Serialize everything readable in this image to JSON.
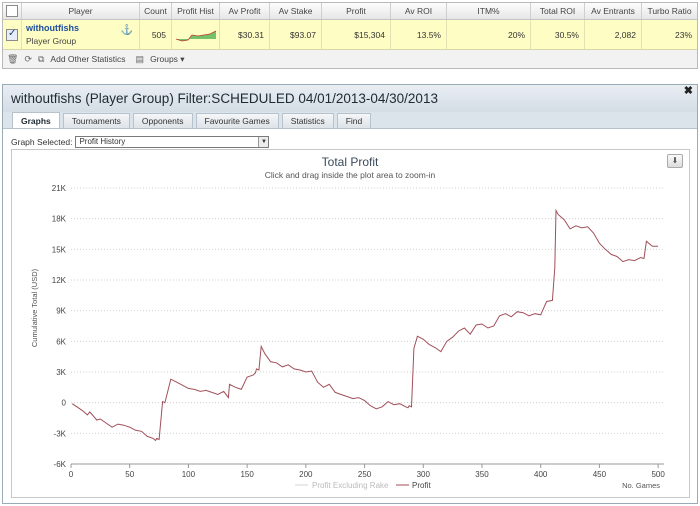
{
  "stats_table": {
    "headers": [
      "Player",
      "Count",
      "Profit Hist",
      "Av Profit",
      "Av Stake",
      "Profit",
      "Av ROI",
      "ITM%",
      "Total ROI",
      "Av Entrants",
      "Turbo Ratio"
    ],
    "row": {
      "player_name": "withoutfishs",
      "player_group": "Player Group",
      "count": "505",
      "av_profit": "$30.31",
      "av_stake": "$93.07",
      "profit": "$15,304",
      "av_roi": "13.5%",
      "itm": "20%",
      "total_roi": "30.5%",
      "av_entrants": "2,082",
      "turbo_ratio": "23%"
    },
    "toolbar": {
      "add_stats_label": "Add Other Statistics",
      "groups_label": "Groups"
    }
  },
  "panel": {
    "title": "withoutfishs (Player Group) Filter:SCHEDULED 04/01/2013-04/30/2013",
    "tabs": [
      "Graphs",
      "Tournaments",
      "Opponents",
      "Favourite Games",
      "Statistics",
      "Find"
    ],
    "active_tab": "Graphs",
    "graph_selected_label": "Graph Selected:",
    "graph_selected_value": "Profit History"
  },
  "colors": {
    "accent_blue": "#1f4fa0",
    "row_highlight": "#fdfdc4",
    "profit_line": "#a0505a",
    "excl_rake_line": "#d6d6d6"
  },
  "chart_data": {
    "type": "line",
    "title": "Total Profit",
    "subtitle": "Click and drag inside the plot area to zoom-in",
    "xlabel": "No. Games",
    "ylabel": "Cumulative Total (USD)",
    "xlim": [
      0,
      505
    ],
    "ylim": [
      -6000,
      21000
    ],
    "xticks": [
      0,
      50,
      100,
      150,
      200,
      250,
      300,
      350,
      400,
      450,
      500
    ],
    "yticks": [
      -6000,
      -3000,
      0,
      3000,
      6000,
      9000,
      12000,
      15000,
      18000,
      21000
    ],
    "ytick_labels": [
      "-6K",
      "-3K",
      "0",
      "3K",
      "6K",
      "9K",
      "12K",
      "15K",
      "18K",
      "21K"
    ],
    "grid": "horizontal-dotted",
    "legend_position": "bottom-center",
    "series": [
      {
        "name": "Profit Excluding Rake",
        "color": "#d6d6d6",
        "visible": false,
        "x": [],
        "y": []
      },
      {
        "name": "Profit",
        "color": "#a0505a",
        "x": [
          1,
          5,
          10,
          14,
          16,
          22,
          25,
          30,
          35,
          40,
          45,
          50,
          55,
          60,
          65,
          70,
          72,
          73,
          75,
          78,
          80,
          85,
          90,
          95,
          100,
          105,
          110,
          115,
          120,
          125,
          130,
          134,
          135,
          140,
          145,
          150,
          155,
          157,
          158,
          160,
          162,
          165,
          170,
          175,
          180,
          185,
          190,
          195,
          200,
          205,
          210,
          215,
          220,
          225,
          230,
          235,
          240,
          245,
          250,
          255,
          260,
          265,
          270,
          275,
          280,
          285,
          287,
          288,
          290,
          292,
          295,
          300,
          305,
          310,
          315,
          320,
          325,
          330,
          335,
          340,
          345,
          350,
          355,
          360,
          365,
          370,
          375,
          380,
          385,
          390,
          395,
          400,
          405,
          410,
          412,
          413,
          415,
          420,
          425,
          430,
          435,
          440,
          445,
          450,
          455,
          460,
          465,
          470,
          475,
          480,
          485,
          488,
          490,
          495,
          500
        ],
        "y": [
          -100,
          -400,
          -800,
          -1200,
          -900,
          -1700,
          -1600,
          -2000,
          -2400,
          -2100,
          -2200,
          -2400,
          -2700,
          -2800,
          -3300,
          -3500,
          -3700,
          -3500,
          -3600,
          100,
          0,
          2300,
          2000,
          1700,
          1400,
          1300,
          1100,
          1200,
          1000,
          800,
          1100,
          500,
          1800,
          1500,
          1300,
          2500,
          2700,
          2900,
          3300,
          3200,
          5500,
          4800,
          4000,
          3900,
          3500,
          3700,
          3300,
          3200,
          3000,
          3100,
          2000,
          1500,
          1800,
          1000,
          800,
          600,
          400,
          500,
          200,
          -300,
          -600,
          -400,
          100,
          -200,
          -100,
          -400,
          -500,
          -300,
          -400,
          5300,
          6500,
          6200,
          5700,
          5400,
          5000,
          6000,
          6400,
          7000,
          7300,
          6700,
          7600,
          7700,
          7300,
          7500,
          8500,
          8700,
          8400,
          8900,
          8800,
          8500,
          8700,
          8600,
          9900,
          10000,
          13200,
          18800,
          18400,
          17900,
          17000,
          17300,
          17100,
          17200,
          16600,
          15600,
          15000,
          14500,
          14300,
          13800,
          14000,
          13900,
          14200,
          14100,
          15800,
          15300,
          15300
        ]
      }
    ]
  }
}
